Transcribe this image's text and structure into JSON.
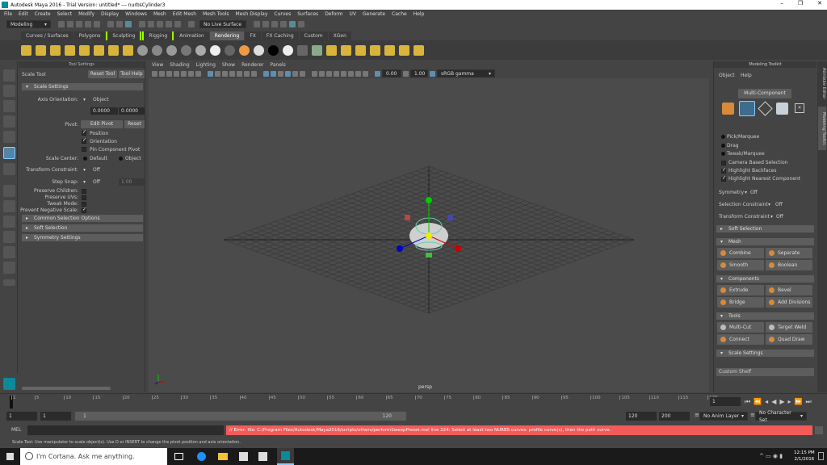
{
  "window": {
    "title": "Autodesk Maya 2016 - Trial Version: untitled*   ---   nurbsCylinder3",
    "minimize": "–",
    "maximize": "❐",
    "close": "✕"
  },
  "menus": [
    "File",
    "Edit",
    "Create",
    "Select",
    "Modify",
    "Display",
    "Windows",
    "Mesh",
    "Edit Mesh",
    "Mesh Tools",
    "Mesh Display",
    "Curves",
    "Surfaces",
    "Deform",
    "UV",
    "Generate",
    "Cache",
    "Help"
  ],
  "status_line": {
    "mode": "Modeling",
    "live_surface": "No Live Surface"
  },
  "shelf_tabs": [
    "Curves / Surfaces",
    "Polygons",
    "Sculpting",
    "Rigging",
    "Animation",
    "Rendering",
    "FX",
    "FX Caching",
    "Custom",
    "XGen"
  ],
  "active_shelf": "Rendering",
  "tool_settings": {
    "panel_title": "Tool Settings",
    "tool_name": "Scale Tool",
    "reset_tool": "Reset Tool",
    "tool_help": "Tool Help",
    "scale_settings": "Scale Settings",
    "axis_orientation_label": "Axis Orientation:",
    "axis_orientation_value": "Object",
    "value1": "0.0000",
    "value2": "0.0000",
    "pivot_label": "Pivot:",
    "edit_pivot": "Edit Pivot",
    "reset": "Reset",
    "position": "Position",
    "orientation": "Orientation",
    "pin_component_pivot": "Pin Component Pivot",
    "scale_center_label": "Scale Center:",
    "default": "Default",
    "object": "Object",
    "transform_constraint_label": "Transform Constraint:",
    "transform_constraint_value": "Off",
    "step_snap_label": "Step Snap:",
    "step_snap_value": "Off",
    "step_snap_num": "1.00",
    "preserve_children": "Preserve Children:",
    "preserve_uvs": "Preserve UVs:",
    "tweak_mode": "Tweak Mode:",
    "prevent_negative_scale": "Prevent Negative Scale:",
    "common_selection_options": "Common Selection Options",
    "soft_selection": "Soft Selection",
    "symmetry_settings": "Symmetry Settings"
  },
  "viewport": {
    "menu": [
      "View",
      "Shading",
      "Lighting",
      "Show",
      "Renderer",
      "Panels"
    ],
    "exposure": "0.00",
    "gamma": "1.00",
    "color_space": "sRGB gamma",
    "camera_label": "persp"
  },
  "modeling_toolkit": {
    "panel_title": "Modeling Toolkit",
    "object_menu": "Object",
    "help_menu": "Help",
    "multi_component": "Multi-Component",
    "pick_marquee": "Pick/Marquee",
    "drag": "Drag",
    "tweak_marquee": "Tweak/Marquee",
    "camera_based_selection": "Camera Based Selection",
    "highlight_backfaces": "Highlight Backfaces",
    "highlight_nearest_component": "Highlight Nearest Component",
    "symmetry_label": "Symmetry",
    "symmetry_value": "Off",
    "selection_constraint_label": "Selection Constraint",
    "selection_constraint_value": "Off",
    "transform_constraint_label": "Transform Constraint",
    "transform_constraint_value": "Off",
    "soft_selection": "Soft Selection",
    "mesh": "Mesh",
    "combine": "Combine",
    "separate": "Separate",
    "smooth": "Smooth",
    "boolean": "Boolean",
    "components": "Components",
    "extrude": "Extrude",
    "bevel": "Bevel",
    "bridge": "Bridge",
    "add_divisions": "Add Divisions",
    "tools": "Tools",
    "multi_cut": "Multi-Cut",
    "target_weld": "Target Weld",
    "connect": "Connect",
    "quad_draw": "Quad Draw",
    "scale_settings": "Scale Settings",
    "custom_shelf": "Custom Shelf"
  },
  "side_tabs": {
    "attribute_editor": "Attribute Editor",
    "modeling_toolkit": "Modeling Toolkit"
  },
  "timeline": {
    "ticks": [
      "1",
      "5",
      "10",
      "15",
      "20",
      "25",
      "30",
      "35",
      "40",
      "45",
      "50",
      "55",
      "60",
      "65",
      "70",
      "75",
      "80",
      "85",
      "90",
      "95",
      "100",
      "105",
      "110",
      "115",
      "120"
    ],
    "current_frame": "1"
  },
  "range": {
    "start1": "1",
    "start2": "1",
    "slider_start": "1",
    "slider_end": "120",
    "end1": "120",
    "end2": "200",
    "anim_layer": "No Anim Layer",
    "character_set": "No Character Set"
  },
  "command_line": {
    "label": "MEL",
    "error": "// Error: file: C:/Program Files/Autodesk/Maya2016/scripts/others/performSweepPreset.mel line 224: Select at least two NURBS curves: profile curve(s), then the path curve."
  },
  "help_line": "Scale Tool: Use manipulator to scale object(s). Use D or INSERT to change the pivot position and axis orientation.",
  "taskbar": {
    "cortana": "I'm Cortana. Ask me anything.",
    "time": "12:15 PM",
    "date": "2/1/2016"
  },
  "colors": {
    "error_bar": "#f35a5a",
    "selected_tool": "#5285a6",
    "active_tab": "#5d5d5d"
  }
}
